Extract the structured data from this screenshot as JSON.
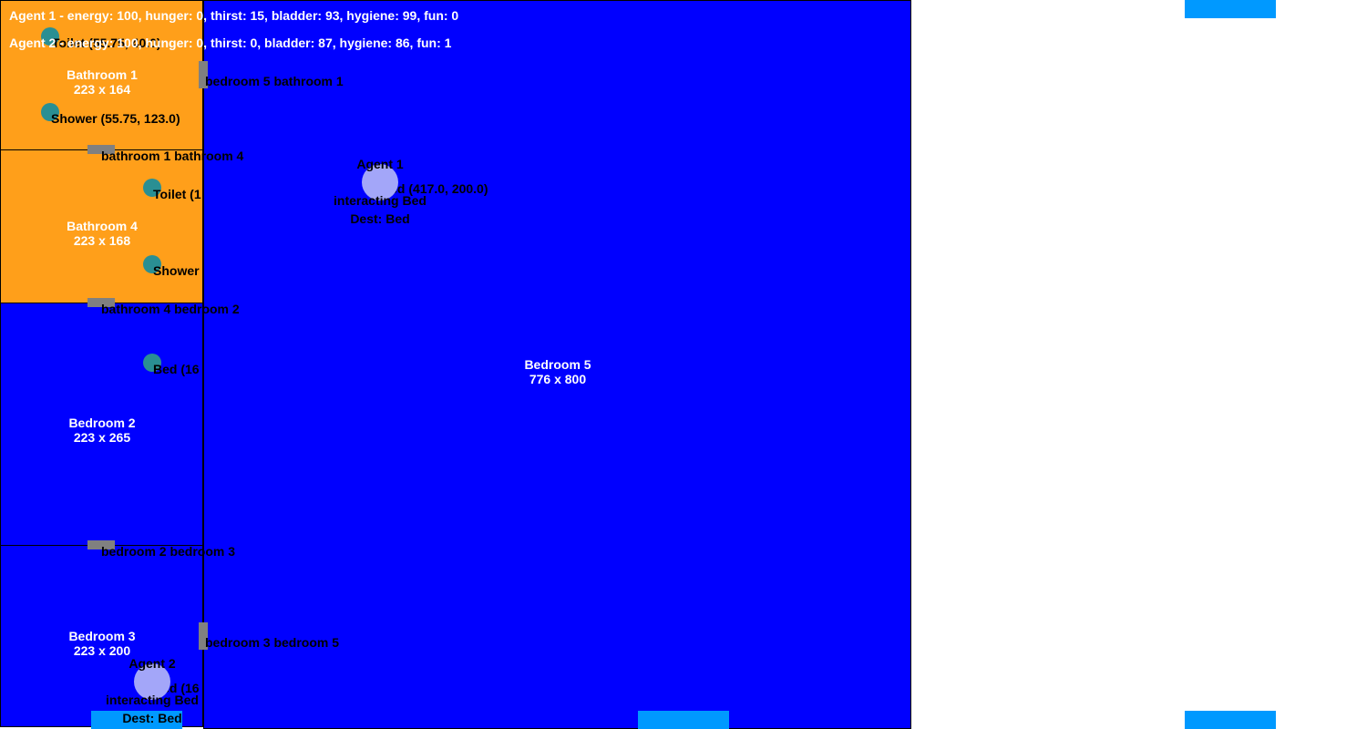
{
  "colors": {
    "bathroom": "#ff9f1a",
    "bedroom": "#0000ff",
    "door": "#808080",
    "object": "#2a8f93",
    "agent": "#a3a6f9",
    "spawn": "#0099ff"
  },
  "rooms": {
    "bathroom1": {
      "name": "Bathroom 1",
      "size": "223 x 164"
    },
    "bathroom4": {
      "name": "Bathroom 4",
      "size": "223 x 168"
    },
    "bedroom2": {
      "name": "Bedroom 2",
      "size": "223 x 265"
    },
    "bedroom3": {
      "name": "Bedroom 3",
      "size": "223 x 200"
    },
    "bedroom5": {
      "name": "Bedroom 5",
      "size": "776 x 800"
    }
  },
  "doors": {
    "bedroom5_bathroom1": "bedroom 5 bathroom 1",
    "bathroom1_bathroom4": "bathroom 1 bathroom 4",
    "bathroom4_bedroom2": "bathroom 4 bedroom 2",
    "bedroom2_bedroom3": "bedroom 2 bedroom 3",
    "bedroom3_bedroom5": "bedroom 3 bedroom 5"
  },
  "objects": {
    "b1_toilet": "Toilet (55.75, 40.0)",
    "b1_shower": "Shower (55.75, 123.0)",
    "b4_toilet": "Toilet (1",
    "b4_shower": "Shower",
    "b2_bed": "Bed (16",
    "b5_bed": "Bed (417.0, 200.0)",
    "b3_bed": "Bed (16"
  },
  "agents": {
    "agent1": {
      "name": "Agent 1",
      "state": "interacting Bed",
      "dest": "Dest: Bed"
    },
    "agent2": {
      "name": "Agent 2",
      "state": "interacting Bed",
      "dest": "Dest: Bed"
    }
  },
  "status": {
    "agent1": "Agent 1 - energy: 100, hunger: 0, thirst: 15, bladder: 93, hygiene: 99, fun: 0",
    "agent2": "Agent 2 - energy: 100, hunger: 0, thirst: 0, bladder: 87, hygiene: 86, fun: 1"
  }
}
